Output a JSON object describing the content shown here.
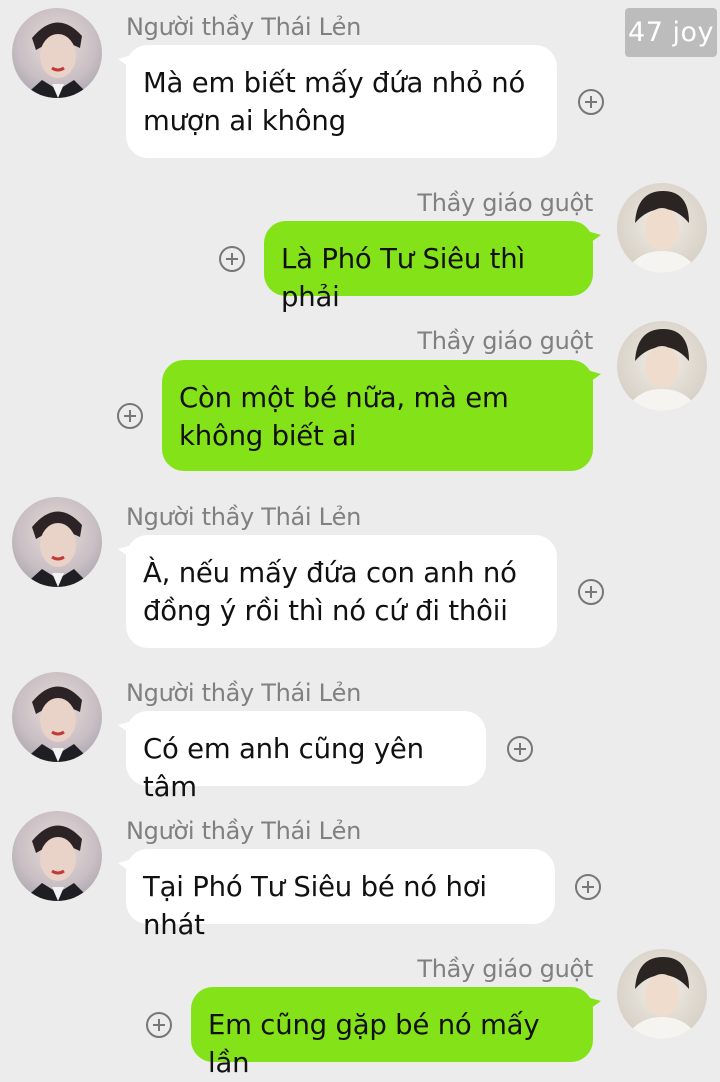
{
  "watermark": "47 joy",
  "participants": {
    "left_name": "Người thầy Thái Lẻn",
    "right_name": "Thầy giáo guột"
  },
  "messages": [
    {
      "sender": "Người thầy Thái Lẻn",
      "side": "left",
      "text": "Mà em biết mấy đứa nhỏ nó\nmượn ai không"
    },
    {
      "sender": "Thầy giáo guột",
      "side": "right",
      "text": "Là Phó Tư Siêu thì phải"
    },
    {
      "sender": "Thầy giáo guột",
      "side": "right",
      "text": "Còn một bé nữa, mà em\nkhông biết ai"
    },
    {
      "sender": "Người thầy Thái Lẻn",
      "side": "left",
      "text": "À, nếu mấy đứa con anh nó\nđồng ý rồi thì nó cứ đi thôii"
    },
    {
      "sender": "Người thầy Thái Lẻn",
      "side": "left",
      "text": "Có em anh cũng yên tâm"
    },
    {
      "sender": "Người thầy Thái Lẻn",
      "side": "left",
      "text": "Tại Phó Tư Siêu bé nó hơi nhát"
    },
    {
      "sender": "Thầy giáo guột",
      "side": "right",
      "text": "Em cũng gặp bé nó mấy lần"
    }
  ],
  "icons": {
    "avatar_left": "avatar-man-dark-suit-icon",
    "avatar_right": "avatar-young-man-icon",
    "react": "add-reaction-icon"
  },
  "colors": {
    "background": "#ececec",
    "incoming_bubble": "#ffffff",
    "outgoing_bubble": "#84e219",
    "name_text": "#808080"
  }
}
